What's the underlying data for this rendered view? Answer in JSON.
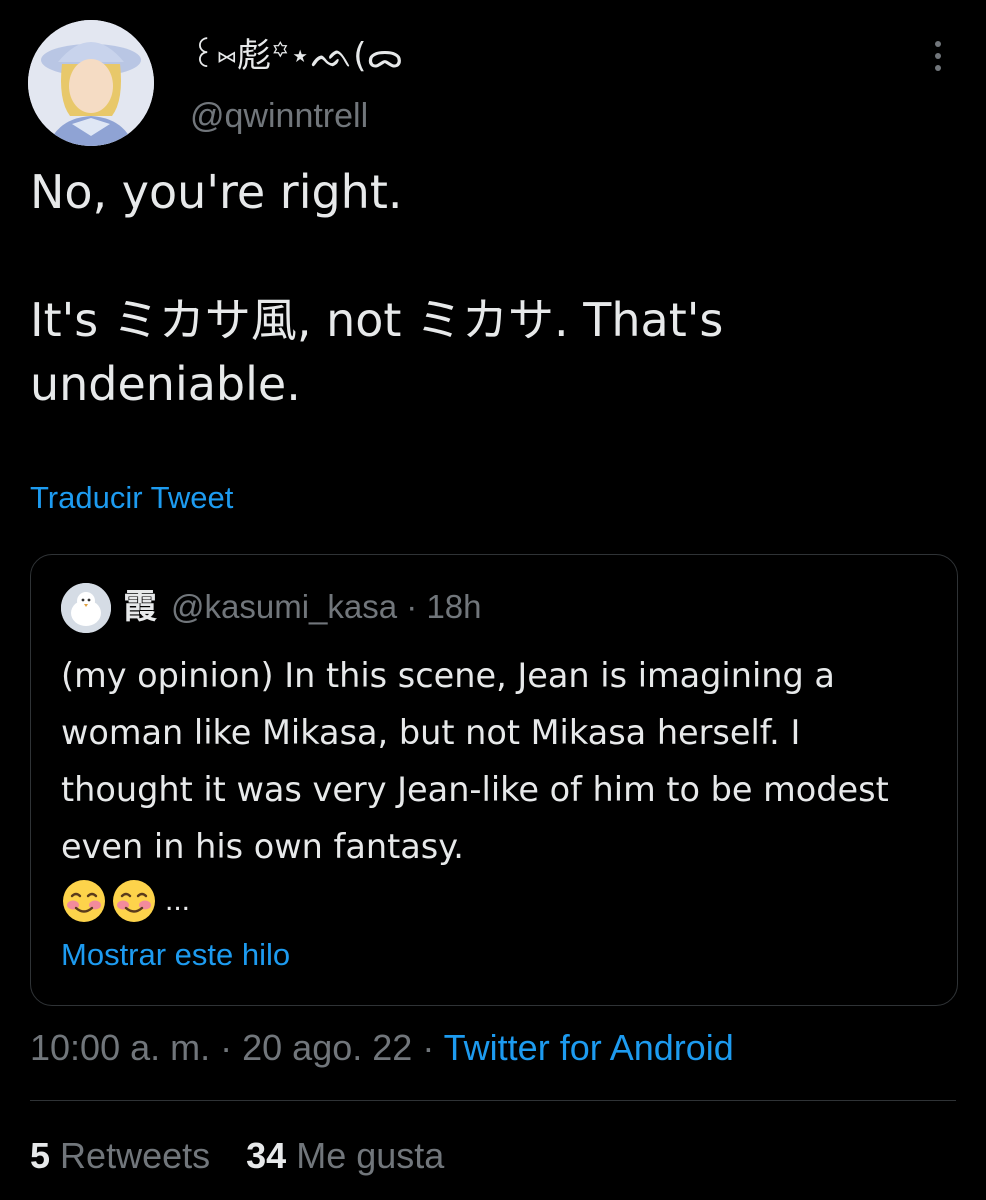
{
  "author": {
    "display_name": "꒰⑅彪꙳⋆ᨒ(ᯅ",
    "handle": "@qwinntrell",
    "avatar": "avatar-anime-woman-hat"
  },
  "more_icon": "more-options-icon",
  "tweet": {
    "text": "No, you're right.\n\nIt's ミカサ風, not ミカサ. That's undeniable.",
    "translate_label": "Traducir Tweet"
  },
  "quote": {
    "avatar": "avatar-white-bird",
    "name": "霞",
    "handle": "@kasumi_kasa",
    "separator": "·",
    "time": "18h",
    "body": "(my opinion) In this scene, Jean is imagining a woman like Mikasa, but not Mikasa herself. I thought it was very Jean-like of him to be modest even in his own fantasy.",
    "emoji": "smiling-face-with-blush-icon",
    "ellipsis": "...",
    "show_thread_label": "Mostrar este hilo"
  },
  "meta": {
    "time": "10:00 a. m.",
    "separator": "·",
    "date": "20 ago. 22",
    "source": "Twitter for Android"
  },
  "stats": {
    "retweets_count": "5",
    "retweets_label": "Retweets",
    "likes_count": "34",
    "likes_label": "Me gusta"
  },
  "colors": {
    "background": "#000000",
    "text": "#e7e9ea",
    "muted": "#71767b",
    "link": "#1d9bf0",
    "border": "#2f3336"
  }
}
